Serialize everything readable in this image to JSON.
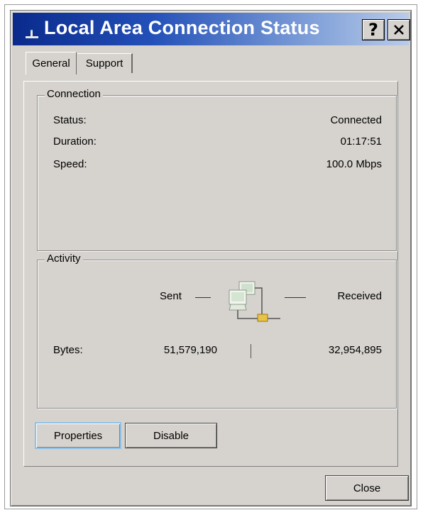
{
  "window": {
    "title": "Local Area Connection Status",
    "help_glyph": "?",
    "close_glyph": "✕"
  },
  "tabs": [
    {
      "label": "General",
      "selected": true
    },
    {
      "label": "Support",
      "selected": false
    }
  ],
  "connection": {
    "legend": "Connection",
    "status_label": "Status:",
    "status_value": "Connected",
    "duration_label": "Duration:",
    "duration_value": "01:17:51",
    "speed_label": "Speed:",
    "speed_value": "100.0 Mbps"
  },
  "activity": {
    "legend": "Activity",
    "sent_label": "Sent",
    "received_label": "Received",
    "bytes_label": "Bytes:",
    "bytes_sent": "51,579,190",
    "bytes_received": "32,954,895",
    "icon": "network-computers-icon"
  },
  "buttons": {
    "properties": "Properties",
    "disable": "Disable",
    "close": "Close"
  },
  "colors": {
    "titlebar_start": "#0a2a8c",
    "titlebar_end": "#b9cbe9",
    "dialog_face": "#d6d3ce",
    "focus_ring": "#8ec2e8"
  }
}
